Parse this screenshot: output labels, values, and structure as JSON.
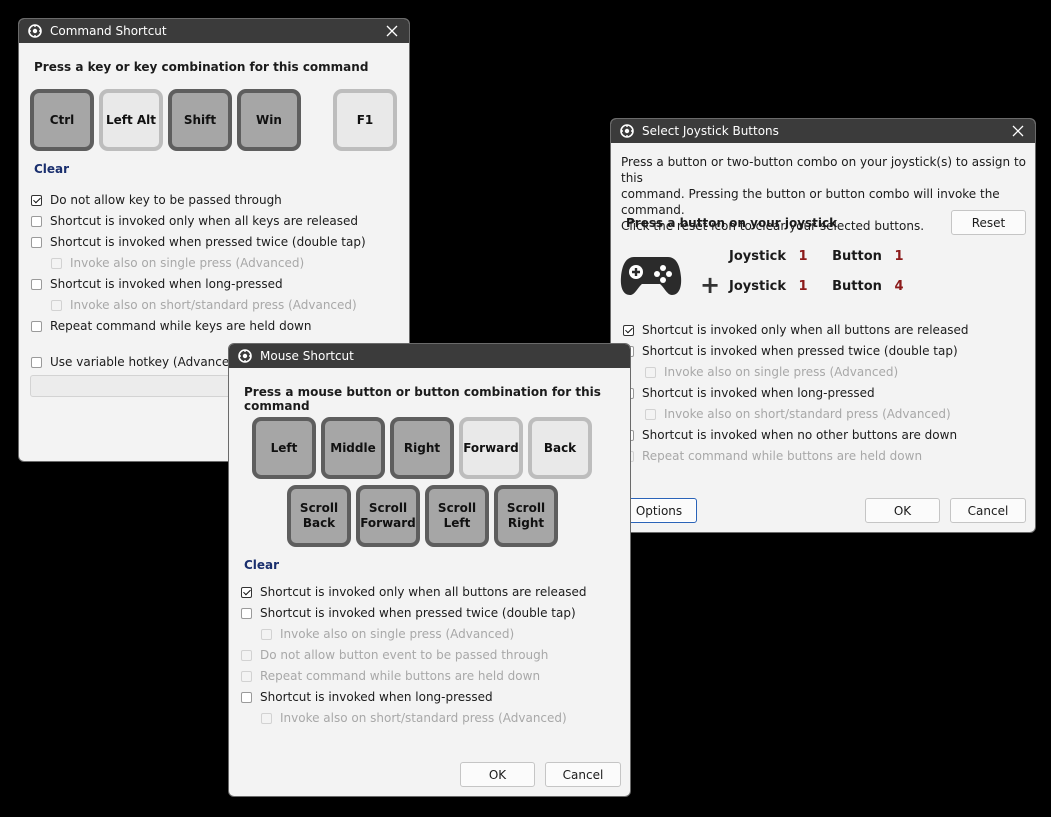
{
  "command_dialog": {
    "title": "Command Shortcut",
    "prompt": "Press a key or key combination for this command",
    "keys": [
      {
        "label": "Ctrl",
        "active": true
      },
      {
        "label": "Left Alt",
        "active": false
      },
      {
        "label": "Shift",
        "active": true
      },
      {
        "label": "Win",
        "active": true
      },
      {
        "label": "F1",
        "active": false
      }
    ],
    "clear_label": "Clear",
    "options": [
      {
        "label": "Do not allow key to be passed through",
        "checked": true,
        "disabled": false
      },
      {
        "label": "Shortcut is invoked only when all keys are released",
        "checked": false,
        "disabled": false
      },
      {
        "label": "Shortcut is invoked when pressed twice (double tap)",
        "checked": false,
        "disabled": false
      },
      {
        "label": "Invoke also on single press (Advanced)",
        "checked": false,
        "disabled": true
      },
      {
        "label": "Shortcut is invoked when long-pressed",
        "checked": false,
        "disabled": false
      },
      {
        "label": "Invoke also on short/standard press (Advanced)",
        "checked": false,
        "disabled": true
      },
      {
        "label": "Repeat command while keys are held down",
        "checked": false,
        "disabled": false
      },
      {
        "label": "Use variable hotkey (Advanced)",
        "checked": false,
        "disabled": false
      }
    ],
    "hotkey_value": ""
  },
  "mouse_dialog": {
    "title": "Mouse Shortcut",
    "prompt": "Press a mouse button or button combination for this command",
    "buttons_row1": [
      {
        "label": "Left",
        "active": true
      },
      {
        "label": "Middle",
        "active": true
      },
      {
        "label": "Right",
        "active": true
      },
      {
        "label": "Forward",
        "active": false
      },
      {
        "label": "Back",
        "active": false
      }
    ],
    "buttons_row2": [
      {
        "line1": "Scroll",
        "line2": "Back",
        "active": true
      },
      {
        "line1": "Scroll",
        "line2": "Forward",
        "active": true
      },
      {
        "line1": "Scroll",
        "line2": "Left",
        "active": true
      },
      {
        "line1": "Scroll",
        "line2": "Right",
        "active": true
      }
    ],
    "clear_label": "Clear",
    "options": [
      {
        "label": "Shortcut is invoked only when all buttons are released",
        "checked": true,
        "disabled": false
      },
      {
        "label": "Shortcut is invoked when pressed twice (double tap)",
        "checked": false,
        "disabled": false
      },
      {
        "label": "Invoke also on single press (Advanced)",
        "checked": false,
        "disabled": true
      },
      {
        "label": "Do not allow button event to be passed through",
        "checked": false,
        "disabled": true
      },
      {
        "label": "Repeat command while buttons are held down",
        "checked": false,
        "disabled": true
      },
      {
        "label": "Shortcut is invoked when long-pressed",
        "checked": false,
        "disabled": false
      },
      {
        "label": "Invoke also on short/standard press (Advanced)",
        "checked": false,
        "disabled": true
      }
    ],
    "ok_label": "OK",
    "cancel_label": "Cancel"
  },
  "joystick_dialog": {
    "title": "Select Joystick Buttons",
    "instructions": [
      "Press a button or two-button combo on your joystick(s) to assign to this",
      "command.  Pressing the button or button combo will invoke the command.",
      "Click the reset icon to clear your selected buttons."
    ],
    "prompt": "Press a button on your joystick",
    "reset_label": "Reset",
    "assignments": [
      {
        "joystick_label": "Joystick",
        "joystick": "1",
        "button_label": "Button",
        "button": "1"
      },
      {
        "joystick_label": "Joystick",
        "joystick": "1",
        "button_label": "Button",
        "button": "4"
      }
    ],
    "plus_symbol": "+",
    "options": [
      {
        "label": "Shortcut is invoked only when all buttons are released",
        "checked": true,
        "disabled": false
      },
      {
        "label": "Shortcut is invoked when pressed twice (double tap)",
        "checked": false,
        "disabled": false
      },
      {
        "label": "Invoke also on single press (Advanced)",
        "checked": false,
        "disabled": true
      },
      {
        "label": "Shortcut is invoked when long-pressed",
        "checked": false,
        "disabled": false
      },
      {
        "label": "Invoke also on short/standard press (Advanced)",
        "checked": false,
        "disabled": true
      },
      {
        "label": "Shortcut is invoked when no other buttons are down",
        "checked": false,
        "disabled": false
      },
      {
        "label": "Repeat command while buttons are held down",
        "checked": false,
        "disabled": true
      }
    ],
    "options_label": "Options",
    "ok_label": "OK",
    "cancel_label": "Cancel"
  }
}
